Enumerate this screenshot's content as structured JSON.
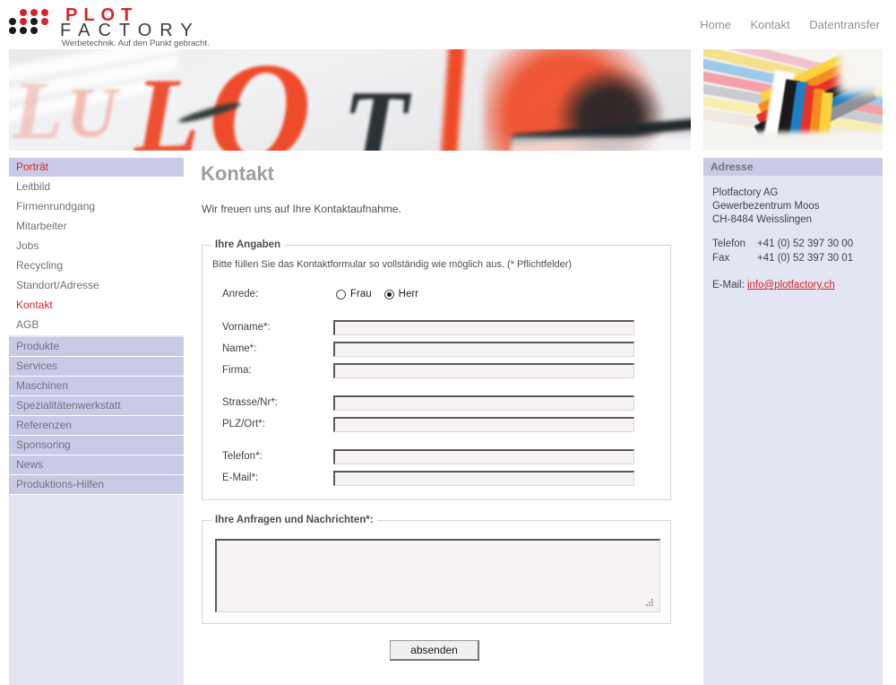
{
  "header": {
    "logo": {
      "word_top": "PLOT",
      "word_bottom": "FACTORY",
      "tagline": "Werbetechnik. Auf den Punkt gebracht.",
      "dot_color_red": "#d8232a",
      "dot_color_black": "#1a1a1a"
    },
    "topnav": [
      {
        "label": "Home"
      },
      {
        "label": "Kontakt"
      },
      {
        "label": "Datentransfer"
      }
    ]
  },
  "banners": {
    "left_alt": "blurred-photo-red-plot-lettering",
    "right_alt": "colored-fabric-stripes-knot-photo"
  },
  "sidebar": {
    "group1": [
      {
        "label": "Porträt",
        "state": "active"
      },
      {
        "label": "Leitbild",
        "state": "normal"
      },
      {
        "label": "Firmenrundgang",
        "state": "normal"
      },
      {
        "label": "Mitarbeiter",
        "state": "normal"
      },
      {
        "label": "Jobs",
        "state": "normal"
      },
      {
        "label": "Recycling",
        "state": "normal"
      },
      {
        "label": "Standort/Adresse",
        "state": "normal"
      },
      {
        "label": "Kontakt",
        "state": "current"
      },
      {
        "label": "AGB",
        "state": "normal"
      }
    ],
    "group2": [
      {
        "label": "Produkte"
      },
      {
        "label": "Services"
      },
      {
        "label": "Maschinen"
      },
      {
        "label": "Spezialitätenwerkstatt"
      },
      {
        "label": "Referenzen"
      },
      {
        "label": "Sponsoring"
      },
      {
        "label": "News"
      },
      {
        "label": "Produktions-Hilfen"
      }
    ],
    "active_color": "#d8232a",
    "item_color": "#6e7378",
    "group_bg": "#c9cbe6"
  },
  "main": {
    "title": "Kontakt",
    "intro": "Wir freuen uns auf Ihre Kontaktaufnahme.",
    "form": {
      "legend": "Ihre Angaben",
      "note": "Bitte füllen Sie das Kontaktformular so vollständig wie möglich aus. (* Pflichtfelder)",
      "salutation": {
        "label": "Anrede:",
        "options": [
          {
            "label": "Frau",
            "selected": false
          },
          {
            "label": "Herr",
            "selected": true
          }
        ]
      },
      "fields": [
        {
          "label": "Vorname*:",
          "value": "",
          "placeholder": ""
        },
        {
          "label": "Name*:",
          "value": "",
          "placeholder": ""
        },
        {
          "label": "Firma:",
          "value": "",
          "placeholder": ""
        },
        {
          "label": "Strasse/Nr*:",
          "value": "",
          "placeholder": ""
        },
        {
          "label": "PLZ/Ort*:",
          "value": "",
          "placeholder": ""
        },
        {
          "label": "Telefon*:",
          "value": "",
          "placeholder": ""
        },
        {
          "label": "E-Mail*:",
          "value": "",
          "placeholder": ""
        }
      ],
      "message": {
        "legend": "Ihre Anfragen und Nachrichten*:",
        "value": "",
        "placeholder": ""
      },
      "submit_label": "absenden"
    }
  },
  "address": {
    "heading": "Adresse",
    "company": "Plotfactory AG",
    "street": "Gewerbezentrum Moos",
    "city": "CH-8484 Weisslingen",
    "phone_label": "Telefon",
    "phone_value": "+41 (0) 52 397 30 00",
    "fax_label": "Fax",
    "fax_value": "+41 (0) 52 397 30 01",
    "email_label": "E-Mail:",
    "email_value": "info@plotfactory.ch",
    "email_color": "#d8232a"
  }
}
